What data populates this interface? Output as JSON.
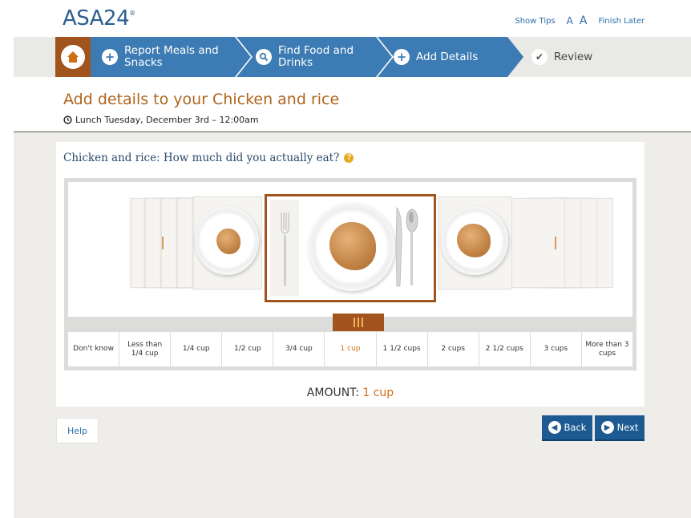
{
  "header": {
    "logo": "ASA24",
    "logo_mark": "®",
    "show_tips": "Show Tips",
    "font_small": "A",
    "font_large": "A",
    "finish_later": "Finish Later"
  },
  "steps": [
    {
      "label_line1": "Report Meals and",
      "label_line2": "Snacks",
      "icon": "plus-icon"
    },
    {
      "label_line1": "Find Food and",
      "label_line2": "Drinks",
      "icon": "search-icon"
    },
    {
      "label_line1": "Add Details",
      "label_line2": "",
      "icon": "plus-icon"
    },
    {
      "label_line1": "Review",
      "label_line2": "",
      "icon": "check-icon"
    }
  ],
  "page": {
    "title": "Add details to your Chicken and rice",
    "meal_info": "Lunch Tuesday, December 3rd – 12:00am"
  },
  "question": {
    "text": "Chicken and rice:  How much did you actually eat?"
  },
  "scale": {
    "options": [
      "Don't know",
      "Less than 1/4 cup",
      "1/4 cup",
      "1/2 cup",
      "3/4 cup",
      "1 cup",
      "1 1/2 cups",
      "2 cups",
      "2 1/2 cups",
      "3 cups",
      "More than 3 cups"
    ],
    "selected_index": 5
  },
  "amount": {
    "label": "AMOUNT:",
    "value": "1 cup"
  },
  "buttons": {
    "help": "Help",
    "back": "Back",
    "next": "Next"
  },
  "colors": {
    "brand_blue": "#3c7bb3",
    "accent_brown": "#a1541d",
    "highlight_orange": "#d26d17"
  }
}
